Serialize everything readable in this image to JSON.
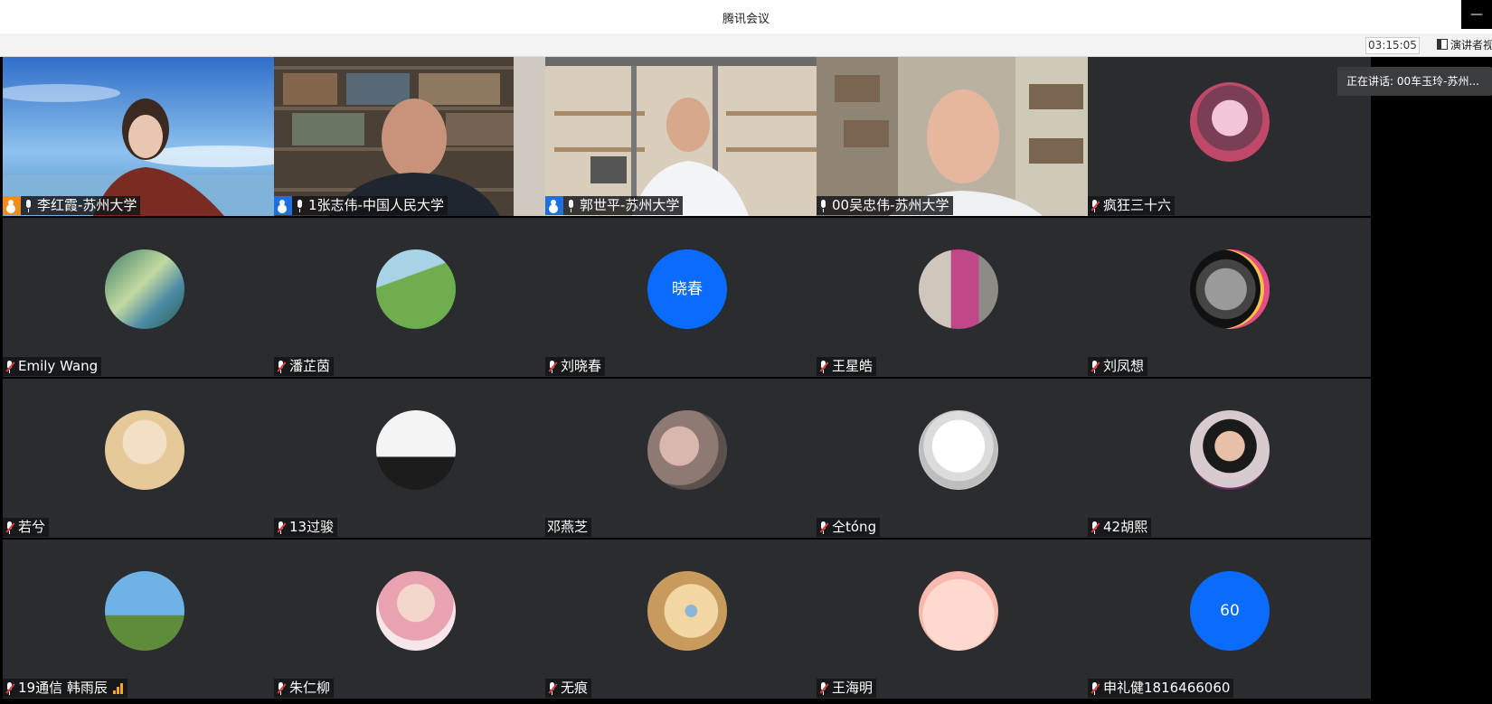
{
  "window": {
    "title": "腾讯会议",
    "minimize_label": "—"
  },
  "toolbar": {
    "timer": "03:15:05",
    "view_label": "演讲者视"
  },
  "speaking": {
    "label": "正在讲话: 00车玉玲-苏州..."
  },
  "participants": [
    {
      "name": "李红霞-苏州大学",
      "host": true,
      "muted": false
    },
    {
      "name": "1张志伟-中国人民大学",
      "host": true,
      "muted": false
    },
    {
      "name": "郭世平-苏州大学",
      "host": true,
      "muted": false
    },
    {
      "name": "00吴忠伟-苏州大学",
      "host": false,
      "muted": false
    },
    {
      "name": "疯狂三十六",
      "host": false,
      "muted": true
    },
    {
      "name": "Emily Wang",
      "muted": true
    },
    {
      "name": "潘芷茵",
      "muted": true
    },
    {
      "name": "刘晓春",
      "muted": true,
      "avatar_text": "晓春"
    },
    {
      "name": "王星皓",
      "muted": true
    },
    {
      "name": "刘凤想",
      "muted": true
    },
    {
      "name": "若兮",
      "muted": true
    },
    {
      "name": "13过骏",
      "muted": true
    },
    {
      "name": "邓燕芝",
      "muted": false,
      "no_mic": true
    },
    {
      "name": "仝tóng",
      "muted": true
    },
    {
      "name": "42胡熙",
      "muted": true
    },
    {
      "name": "19通信 韩雨辰",
      "muted": true,
      "signal": true
    },
    {
      "name": "朱仁柳",
      "muted": true
    },
    {
      "name": "无痕",
      "muted": true
    },
    {
      "name": "王海明",
      "muted": true
    },
    {
      "name": "申礼健1816466060",
      "muted": true,
      "avatar_text": "60"
    }
  ],
  "colors": {
    "tile_bg": "#2b2c30",
    "accent": "#0a6cff",
    "mute_red": "#e63b3b",
    "signal": "#f5a623"
  }
}
